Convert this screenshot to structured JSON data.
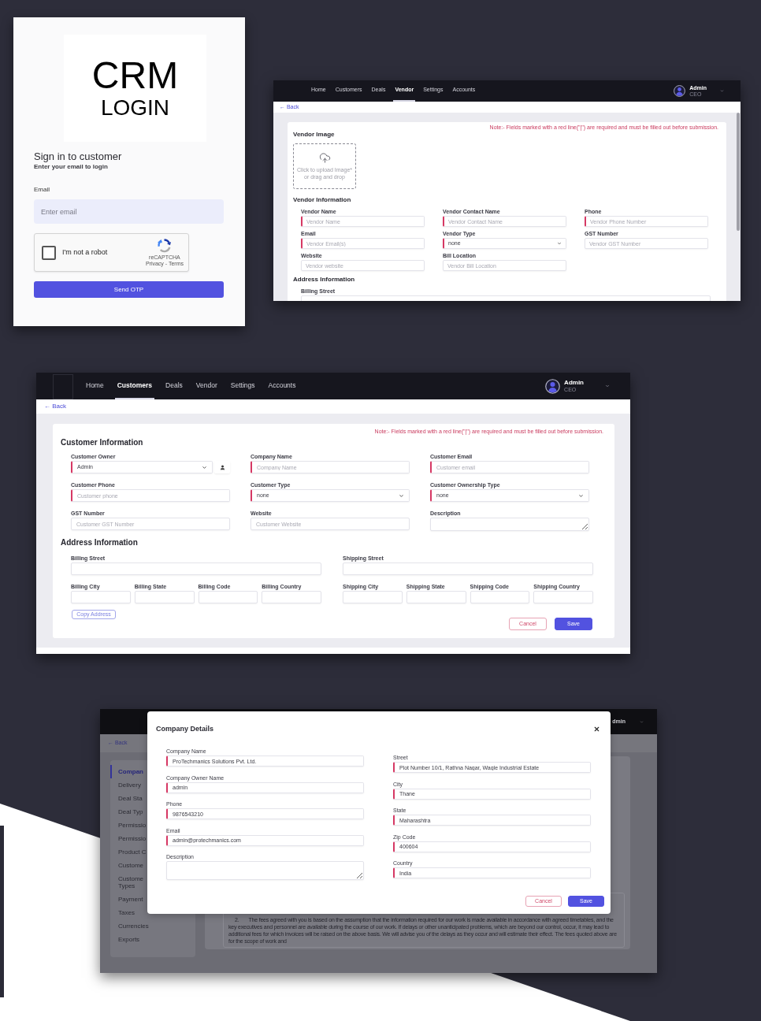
{
  "login_screen": {
    "logo": {
      "title": "CRM",
      "subtitle": "LOGIN"
    },
    "heading": "Sign in to customer",
    "subheading": "Enter your email to login",
    "email_field": {
      "label": "Email",
      "placeholder": "Enter email"
    },
    "captcha": {
      "label": "I'm not a robot",
      "checked": false,
      "brand": "reCAPTCHA",
      "links": "Privacy - Terms"
    },
    "submit_button": "Send OTP"
  },
  "vendor_screen": {
    "nav": {
      "items": [
        {
          "label": "Home",
          "selected": false
        },
        {
          "label": "Customers",
          "selected": false
        },
        {
          "label": "Deals",
          "selected": false
        },
        {
          "label": "Vendor",
          "selected": true
        },
        {
          "label": "Settings",
          "selected": false
        },
        {
          "label": "Accounts",
          "selected": false
        }
      ],
      "user": {
        "name": "Admin",
        "role": "CEO"
      }
    },
    "back_link": "← Back",
    "note": "Note:- Fields marked with a red line(\"|\") are required and must be filled out before submission.",
    "image_section": {
      "title": "Vendor Image",
      "upload_text": "Click to upload Image* or drag and drop"
    },
    "info_section": {
      "title": "Vendor Information",
      "fields": [
        {
          "label": "Vendor Name",
          "kind": "input",
          "placeholder": "Vendor Name",
          "required": true
        },
        {
          "label": "Vendor Contact Name",
          "kind": "input",
          "placeholder": "Vendor Contact Name",
          "required": true
        },
        {
          "label": "Phone",
          "kind": "input",
          "placeholder": "Vendor Phone Number",
          "required": true
        },
        {
          "label": "Email",
          "kind": "input",
          "placeholder": "Vendor Email(s)",
          "required": true
        },
        {
          "label": "Vendor Type",
          "kind": "select",
          "value": "none",
          "required": true
        },
        {
          "label": "GST Number",
          "kind": "input",
          "placeholder": "Vendor GST Number",
          "required": false
        },
        {
          "label": "Website",
          "kind": "input",
          "placeholder": "Vendor website",
          "required": false
        },
        {
          "label": "Bill Location",
          "kind": "input",
          "placeholder": "Vendor Bill Location",
          "required": false
        }
      ]
    },
    "address_section": {
      "title": "Address Information",
      "fields": [
        {
          "label": "Billing Street",
          "kind": "input",
          "required": false
        }
      ]
    }
  },
  "customer_screen": {
    "nav": {
      "items": [
        {
          "label": "Home",
          "selected": false
        },
        {
          "label": "Customers",
          "selected": true
        },
        {
          "label": "Deals",
          "selected": false
        },
        {
          "label": "Vendor",
          "selected": false
        },
        {
          "label": "Settings",
          "selected": false
        },
        {
          "label": "Accounts",
          "selected": false
        }
      ],
      "user": {
        "name": "Admin",
        "role": "CEO"
      }
    },
    "back_link": "← Back",
    "note": "Note:- Fields marked with a red line(\"|\") are required and must be filled out before submission.",
    "info_section": {
      "title": "Customer Information",
      "fields": [
        {
          "label": "Customer Owner",
          "kind": "owner_select",
          "value": "Admin",
          "required": true
        },
        {
          "label": "Company Name",
          "kind": "input",
          "placeholder": "Company Name",
          "required": true
        },
        {
          "label": "Customer Email",
          "kind": "input",
          "placeholder": "Customer email",
          "required": true
        },
        {
          "label": "Customer Phone",
          "kind": "input",
          "placeholder": "Customer phone",
          "required": true
        },
        {
          "label": "Customer Type",
          "kind": "select",
          "value": "none",
          "required": true
        },
        {
          "label": "Customer Ownership Type",
          "kind": "select",
          "value": "none",
          "required": true
        },
        {
          "label": "GST Number",
          "kind": "input",
          "placeholder": "Customer GST Number",
          "required": false
        },
        {
          "label": "Website",
          "kind": "input",
          "placeholder": "Customer Website",
          "required": false
        },
        {
          "label": "Description",
          "kind": "textarea",
          "required": false
        }
      ]
    },
    "address_section": {
      "title": "Address Information",
      "billing": [
        {
          "label": "Billing Street",
          "kind": "input",
          "required": false
        },
        {
          "label": "Billing City",
          "kind": "input",
          "required": false
        },
        {
          "label": "Billing State",
          "kind": "input",
          "required": false
        },
        {
          "label": "Billing Code",
          "kind": "input",
          "required": false
        },
        {
          "label": "Billing Country",
          "kind": "input",
          "required": false
        }
      ],
      "shipping": [
        {
          "label": "Shipping Street",
          "kind": "input",
          "required": false
        },
        {
          "label": "Shipping City",
          "kind": "input",
          "required": false
        },
        {
          "label": "Shipping State",
          "kind": "input",
          "required": false
        },
        {
          "label": "Shipping Code",
          "kind": "input",
          "required": false
        },
        {
          "label": "Shipping Country",
          "kind": "input",
          "required": false
        }
      ]
    },
    "copy_address_button": "Copy Address",
    "buttons": [
      {
        "label": "Cancel",
        "kind": "secondary"
      },
      {
        "label": "Save",
        "kind": "primary"
      }
    ]
  },
  "company_screen": {
    "background": {
      "user_name": "dmin",
      "back_link": "← Back",
      "sidebar": [
        {
          "label": "Compan",
          "selected": true
        },
        {
          "label": "Delivery",
          "selected": false
        },
        {
          "label": "Deal Sta",
          "selected": false
        },
        {
          "label": "Deal Typ",
          "selected": false
        },
        {
          "label": "Permissio",
          "selected": false
        },
        {
          "label": "Permissio",
          "selected": false
        },
        {
          "label": "Product C",
          "selected": false
        },
        {
          "label": "Custome",
          "selected": false
        },
        {
          "label": "Custome\nTypes",
          "selected": false
        },
        {
          "label": "Payment",
          "selected": false
        },
        {
          "label": "Taxes",
          "selected": false
        },
        {
          "label": "Currencies",
          "selected": false
        },
        {
          "label": "Exports",
          "selected": false
        }
      ],
      "paragraph": {
        "number": "2.",
        "text": "The fees agreed with you is based on the assumption that the information required for our work is made available in accordance with agreed timetables, and the key executives and personnel are available during the course of our work. If delays or other unanticipated problems, which are beyond our control, occur, it may lead to additional fees for which invoices will be raised on the above basis. We will advise you of the delays as they occur and will estimate their effect. The fees quoted above are for the scope of work and"
      }
    },
    "modal": {
      "title": "Company Details",
      "left_fields": [
        {
          "label": "Company Name",
          "kind": "input",
          "value": "ProTechmanics Solutions Pvt. Ltd.",
          "required": true
        },
        {
          "label": "Company Owner Name",
          "kind": "input",
          "value": "admin",
          "required": true
        },
        {
          "label": "Phone",
          "kind": "input",
          "value": "9876543210",
          "required": true
        },
        {
          "label": "Email",
          "kind": "input",
          "value": "admin@protechmanics.com",
          "required": true
        },
        {
          "label": "Description",
          "kind": "textarea",
          "required": false
        }
      ],
      "right_fields": [
        {
          "label": "Street",
          "kind": "input",
          "value": "Plot Number 10/1, Rathna Nagar, Wagle Industrial Estate",
          "required": true
        },
        {
          "label": "City",
          "kind": "input",
          "value": "Thane",
          "required": true
        },
        {
          "label": "State",
          "kind": "input",
          "value": "Maharashtra",
          "required": true
        },
        {
          "label": "Zip Code",
          "kind": "input",
          "value": "400604",
          "required": true
        },
        {
          "label": "Country",
          "kind": "input",
          "value": "India",
          "required": true
        }
      ],
      "buttons": [
        {
          "label": "Cancel",
          "kind": "secondary"
        },
        {
          "label": "Save",
          "kind": "primary"
        }
      ]
    }
  }
}
